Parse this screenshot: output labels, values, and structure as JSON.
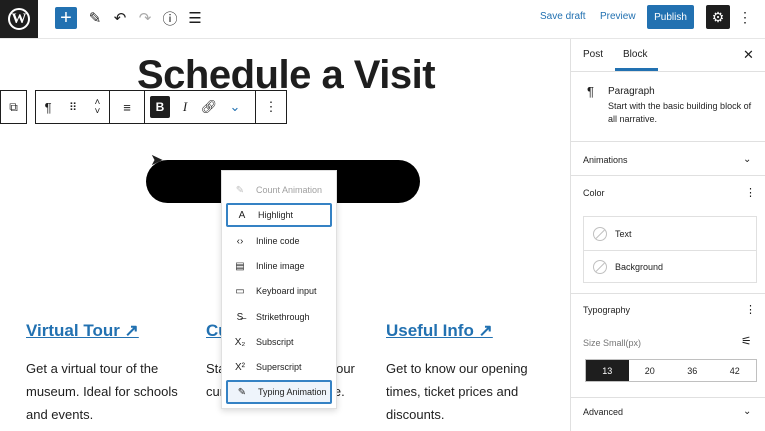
{
  "topbar": {
    "logo_letter": "W",
    "add_icon": "plus-icon",
    "tool_icons": [
      "pencil-icon",
      "undo-icon",
      "redo-icon",
      "info-icon",
      "list-view-icon"
    ],
    "save_draft": "Save draft",
    "preview": "Preview",
    "publish": "Publish"
  },
  "editor": {
    "title": "Schedule a Visit",
    "block_toolbar": {
      "paragraph_icon": "¶",
      "bold": "B",
      "italic": "I"
    },
    "columns": [
      {
        "heading": "Virtual Tour ↗",
        "text": "Get a virtual tour of the museum. Ideal for schools and events."
      },
      {
        "heading": "Cu",
        "text": "Stay updated and see our current exhibitions here."
      },
      {
        "heading": "Useful Info ↗",
        "text": "Get to know our opening times, ticket prices and discounts."
      }
    ]
  },
  "dropdown": {
    "items": [
      {
        "icon": "✎",
        "label": "Count Animation"
      },
      {
        "icon": "A",
        "label": "Highlight"
      },
      {
        "icon": "‹›",
        "label": "Inline code"
      },
      {
        "icon": "▤",
        "label": "Inline image"
      },
      {
        "icon": "▭",
        "label": "Keyboard input"
      },
      {
        "icon": "S̶",
        "label": "Strikethrough"
      },
      {
        "icon": "X₂",
        "label": "Subscript"
      },
      {
        "icon": "X²",
        "label": "Superscript"
      },
      {
        "icon": "✎",
        "label": "Typing Animation"
      }
    ]
  },
  "sidebar": {
    "tabs": [
      "Post",
      "Block"
    ],
    "active_tab": "Block",
    "block_icon": "¶",
    "block_name": "Paragraph",
    "block_description": "Start with the basic building block of all narrative.",
    "panels": {
      "animations": "Animations",
      "color": "Color",
      "color_items": [
        "Text",
        "Background"
      ],
      "typography": "Typography",
      "size_label": "Size Small(px)",
      "sizes": [
        "13",
        "20",
        "36",
        "42"
      ],
      "active_size": "13",
      "advanced": "Advanced"
    }
  },
  "colors": {
    "accent": "#2271b1",
    "dark": "#1e1e1e"
  }
}
